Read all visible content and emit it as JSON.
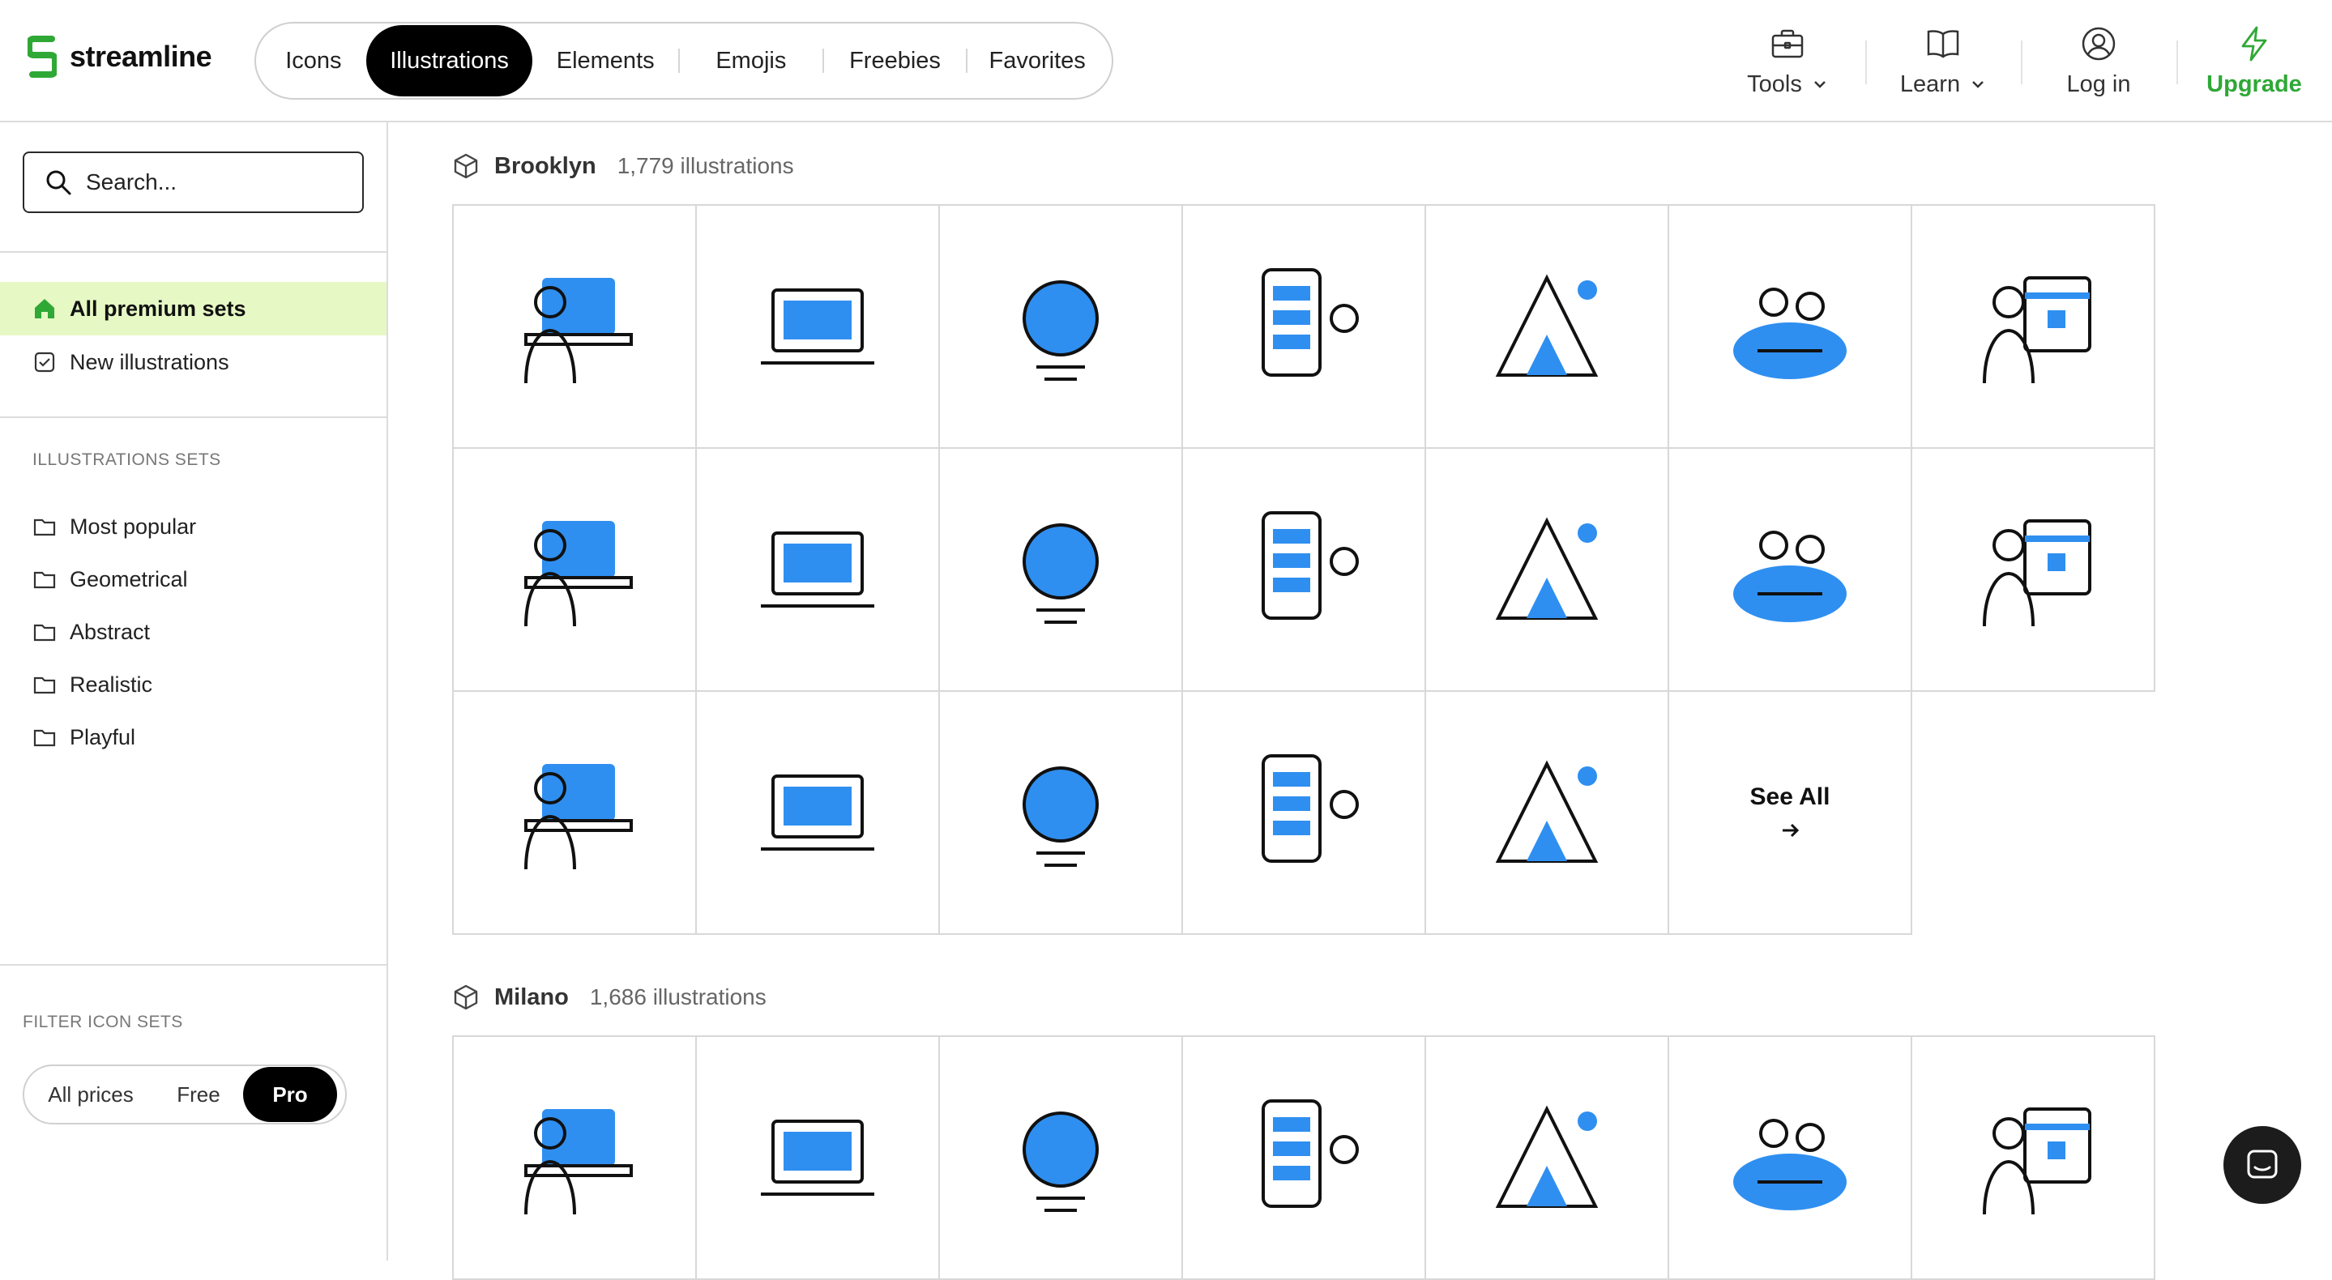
{
  "brand": {
    "name": "streamline",
    "color": "#2fa836"
  },
  "nav": {
    "tabs": [
      {
        "label": "Icons",
        "active": false
      },
      {
        "label": "Illustrations",
        "active": true
      },
      {
        "label": "Elements",
        "active": false
      },
      {
        "label": "Emojis",
        "active": false
      },
      {
        "label": "Freebies",
        "active": false
      },
      {
        "label": "Favorites",
        "active": false
      }
    ]
  },
  "header_actions": [
    {
      "label": "Tools",
      "icon": "briefcase-icon",
      "dropdown": true
    },
    {
      "label": "Learn",
      "icon": "book-icon",
      "dropdown": true
    },
    {
      "label": "Log in",
      "icon": "user-circle-icon",
      "dropdown": false
    },
    {
      "label": "Upgrade",
      "icon": "lightning-icon",
      "dropdown": false
    }
  ],
  "sidebar": {
    "search_placeholder": "Search...",
    "primary_items": [
      {
        "label": "All premium sets",
        "icon": "home-icon",
        "active": true
      },
      {
        "label": "New illustrations",
        "icon": "checkbox-icon",
        "active": false
      }
    ],
    "sets_heading": "ILLUSTRATIONS SETS",
    "sets": [
      {
        "label": "Most popular"
      },
      {
        "label": "Geometrical"
      },
      {
        "label": "Abstract"
      },
      {
        "label": "Realistic"
      },
      {
        "label": "Playful"
      }
    ],
    "filter_heading": "FILTER ICON SETS",
    "price_filter": [
      {
        "label": "All prices",
        "active": false
      },
      {
        "label": "Free",
        "active": false
      },
      {
        "label": "Pro",
        "active": true
      }
    ]
  },
  "sections": [
    {
      "title": "Brooklyn",
      "count": "1,779 illustrations",
      "see_all": "See All",
      "items": [
        "thinking-brain",
        "night-desk-computer",
        "laptop-chat-messages",
        "laptop-vacation",
        "team-workflow",
        "rocket-launch-team",
        "calendar-planning",
        "phone-marketing",
        "city-bicycle",
        "remote-office-chair",
        "team-hands-together",
        "team-discussion",
        "running-treadmill",
        "beanbag-friends",
        "idea-puzzle",
        "relaxing-armchair",
        "growth-chart-team",
        "documents-folder",
        "idea-lightbulb-collaboration"
      ]
    },
    {
      "title": "Milano",
      "count": "1,686 illustrations",
      "items": [
        "rating-review",
        "construction-laptop",
        "creative-brain",
        "document-printer",
        "home-office-desk",
        "atm-keypad",
        "office-chair-boxes"
      ]
    }
  ],
  "colors": {
    "accent_blue": "#2f8ff0",
    "active_green_bg": "#e6f8c4",
    "upgrade_green": "#2fa836"
  }
}
